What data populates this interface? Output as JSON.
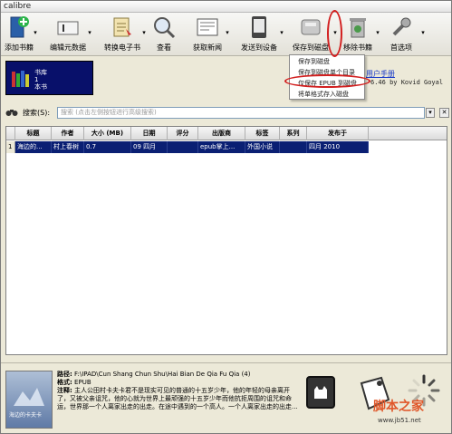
{
  "window": {
    "title": "calibre"
  },
  "toolbar": {
    "add_books": "添加书籍",
    "edit_metadata": "编辑元数据",
    "convert_books": "转换电子书",
    "view": "查看",
    "fetch_news": "获取新闻",
    "send_to_device": "发送到设备",
    "save_to_disk": "保存到磁盘",
    "remove_books": "移除书籍",
    "preferences": "首选项"
  },
  "save_menu": {
    "items": [
      "保存到磁盘",
      "保存到磁盘单个目录",
      "仅保存 EPUB 到磁盘",
      "将单格式存入磁盘"
    ]
  },
  "library": {
    "line1": "书库",
    "line2": "1",
    "line3": "本书"
  },
  "help": {
    "link": "用户手册",
    "version": "6.46 by Kovid Goyal"
  },
  "search": {
    "label": "搜索(S):",
    "placeholder": "搜索 (点击左侧按钮进行高级搜索)"
  },
  "table": {
    "columns": [
      "标题",
      "作者",
      "大小 (MB)",
      "日期",
      "评分",
      "出版商",
      "标签",
      "系列",
      "发布于"
    ],
    "rows": [
      {
        "num": "1",
        "title": "海边的...",
        "author": "村上春树",
        "size": "0.7",
        "date": "09 四月",
        "rating": "",
        "publisher": "epub掌上...",
        "tags": "外国小说",
        "series": "",
        "published": "四月 2010"
      }
    ]
  },
  "details": {
    "cover_text": "海边的卡夫卡",
    "path_label": "路径:",
    "path_value": "F:\\IPAD\\Cun Shang Chun Shu\\Hai Bian De Qia Fu Qia (4)",
    "format_label": "格式:",
    "format_value": "EPUB",
    "comments_label": "注释:",
    "comments_value": "主人公田村卡夫卡君不是现实可见的普通的十五岁少年，他的年轻的母亲离开了，又被父亲诅咒，他的心就为世界上最顽强的十五岁少年而他抗拒周围的诅咒和命运，世界那一个人离家出走的出走。在途中遇到的一个高人。一个人离家出走的出走..."
  },
  "watermark": {
    "main": "脚本之家",
    "url": "www.jb51.net"
  },
  "colors": {
    "accent": "#0a1f73",
    "highlight_circle": "#d21f1f",
    "link": "#1a3cc8"
  }
}
